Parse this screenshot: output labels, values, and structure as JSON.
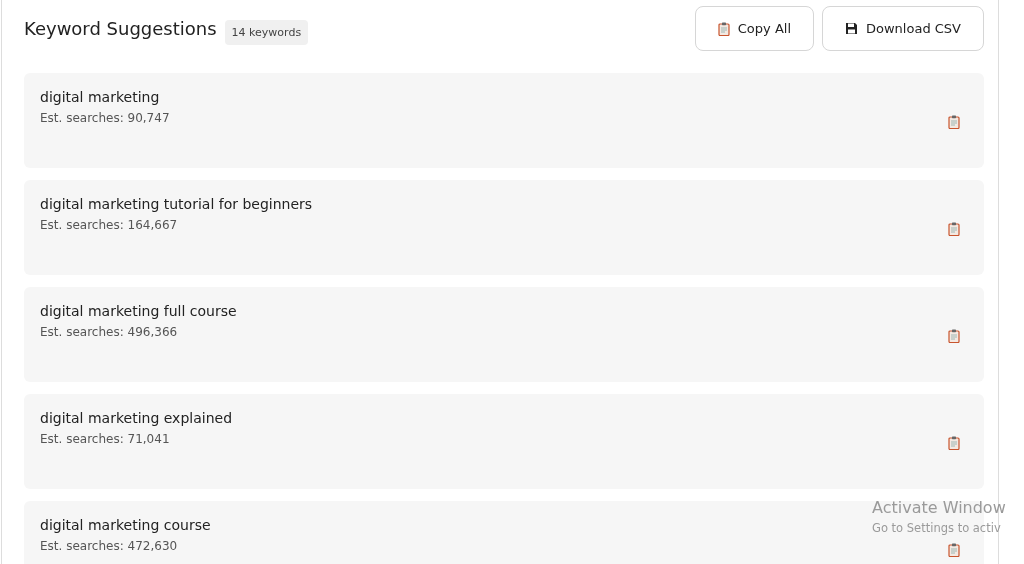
{
  "header": {
    "title": "Keyword Suggestions",
    "count_badge": "14 keywords",
    "buttons": [
      {
        "kind": "copy",
        "label": "Copy All"
      },
      {
        "kind": "download",
        "label": "Download CSV"
      }
    ]
  },
  "keywords": [
    {
      "keyword": "digital marketing",
      "searches": "Est. searches: 90,747"
    },
    {
      "keyword": "digital marketing tutorial for beginners",
      "searches": "Est. searches: 164,667"
    },
    {
      "keyword": "digital marketing full course",
      "searches": "Est. searches: 496,366"
    },
    {
      "keyword": "digital marketing explained",
      "searches": "Est. searches: 71,041"
    },
    {
      "keyword": "digital marketing course",
      "searches": "Est. searches: 472,630"
    }
  ],
  "os_overlay": {
    "title": "Activate Window",
    "subtitle": "Go to Settings to activ"
  }
}
